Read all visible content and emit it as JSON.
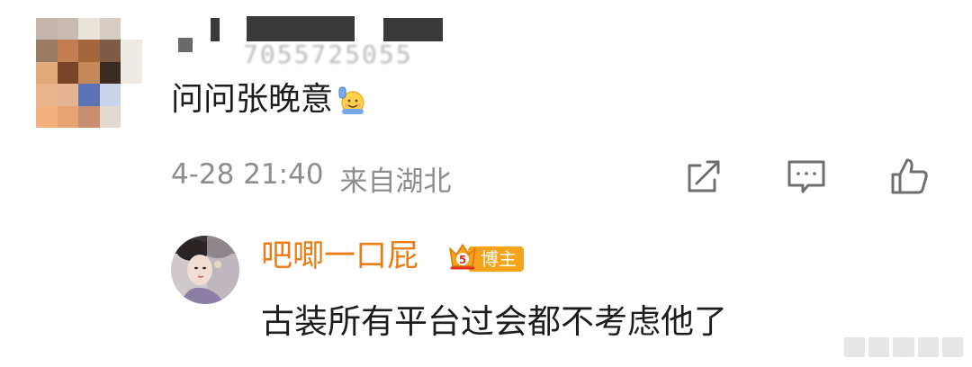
{
  "comment": {
    "username_visible_fragment": "7055725055",
    "text": "问问张晚意",
    "emoji": "wave-emoji",
    "timestamp": "4-28 21:40",
    "location": "来自湖北",
    "actions": [
      "share-icon",
      "comment-icon",
      "like-icon"
    ]
  },
  "reply": {
    "username": "吧唧一口屁",
    "badge_label": "博主",
    "vip_level": "5",
    "text": "古装所有平台过会都不考虑他了"
  },
  "colors": {
    "reply_name": "#ec7c17",
    "badge_bg": "#f6a21b",
    "meta_text": "#8d8d8d",
    "icon_stroke": "#6f6f6f"
  }
}
